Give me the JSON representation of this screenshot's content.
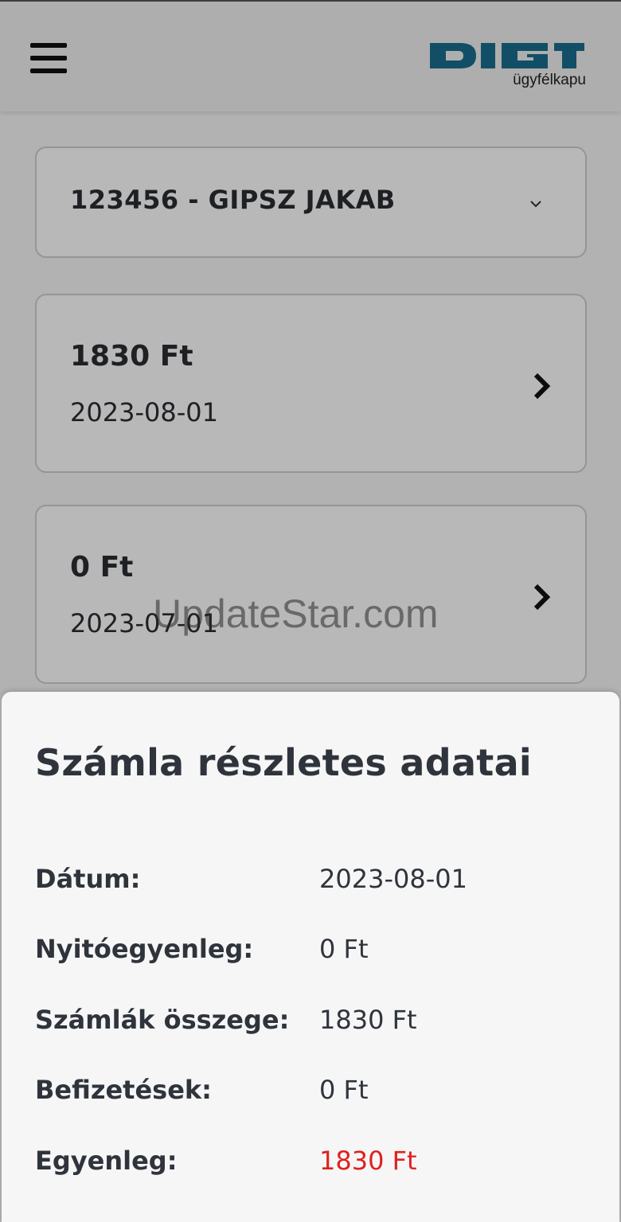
{
  "header": {
    "logo_text": "DIGI",
    "logo_subtitle": "ügyfélkapu",
    "brand_color": "#1a6e8e"
  },
  "account": {
    "selected": "123456 - GIPSZ JAKAB"
  },
  "bills": [
    {
      "amount": "1830 Ft",
      "date": "2023-08-01"
    },
    {
      "amount": "0 Ft",
      "date": "2023-07-01"
    }
  ],
  "watermark": "UpdateStar.com",
  "details": {
    "title": "Számla részletes adatai",
    "rows": [
      {
        "label": "Dátum:",
        "value": "2023-08-01"
      },
      {
        "label": "Nyitóegyenleg:",
        "value": "0 Ft"
      },
      {
        "label": "Számlák összege:",
        "value": "1830 Ft"
      },
      {
        "label": "Befizetések:",
        "value": "0 Ft"
      },
      {
        "label": "Egyenleg:",
        "value": "1830 Ft",
        "color": "#e02020"
      }
    ]
  }
}
